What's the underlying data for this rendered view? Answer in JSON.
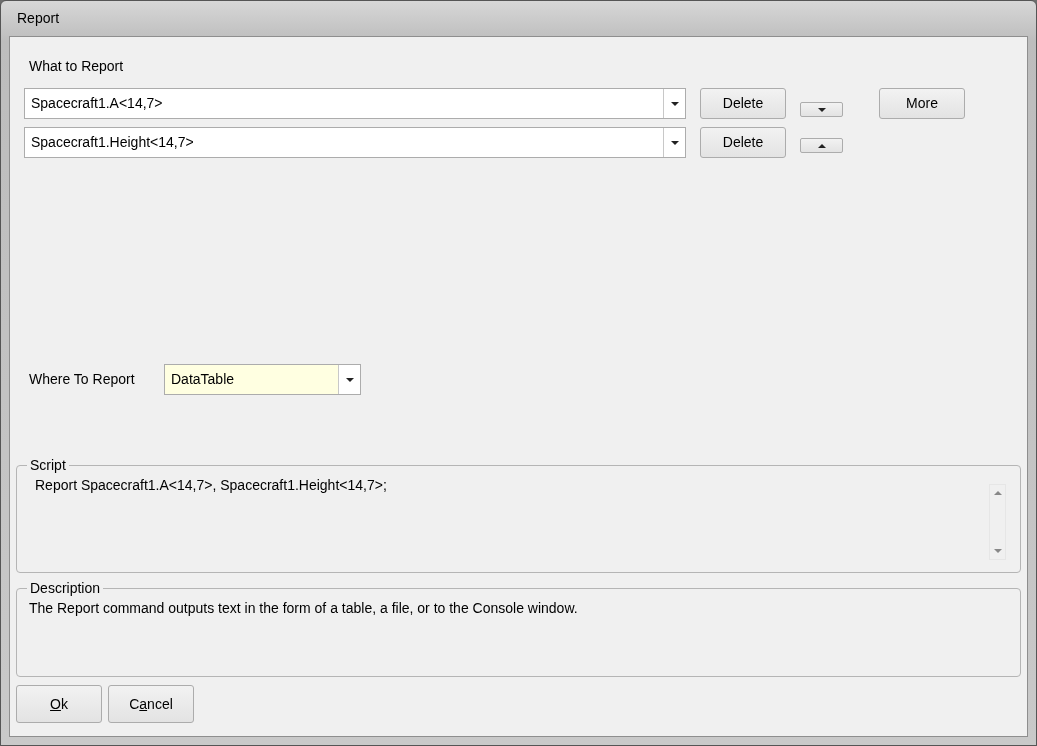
{
  "window": {
    "title": "Report"
  },
  "what_to_report": {
    "label": "What to Report",
    "items": [
      {
        "value": "Spacecraft1.A<14,7>",
        "delete_button": "Delete"
      },
      {
        "value": "Spacecraft1.Height<14,7>",
        "delete_button": "Delete"
      }
    ],
    "more_button": "More"
  },
  "where_to_report": {
    "label": "Where To Report",
    "value": "DataTable"
  },
  "script": {
    "legend": "Script",
    "text": "Report Spacecraft1.A<14,7>, Spacecraft1.Height<14,7>;"
  },
  "description": {
    "legend": "Description",
    "text": "The Report command outputs text in the form of a table, a file, or to the Console window."
  },
  "buttons": [
    {
      "access_key": "O",
      "after_key": "k"
    },
    {
      "before_key": "C",
      "access_key": "a",
      "after_key": "ncel"
    }
  ]
}
